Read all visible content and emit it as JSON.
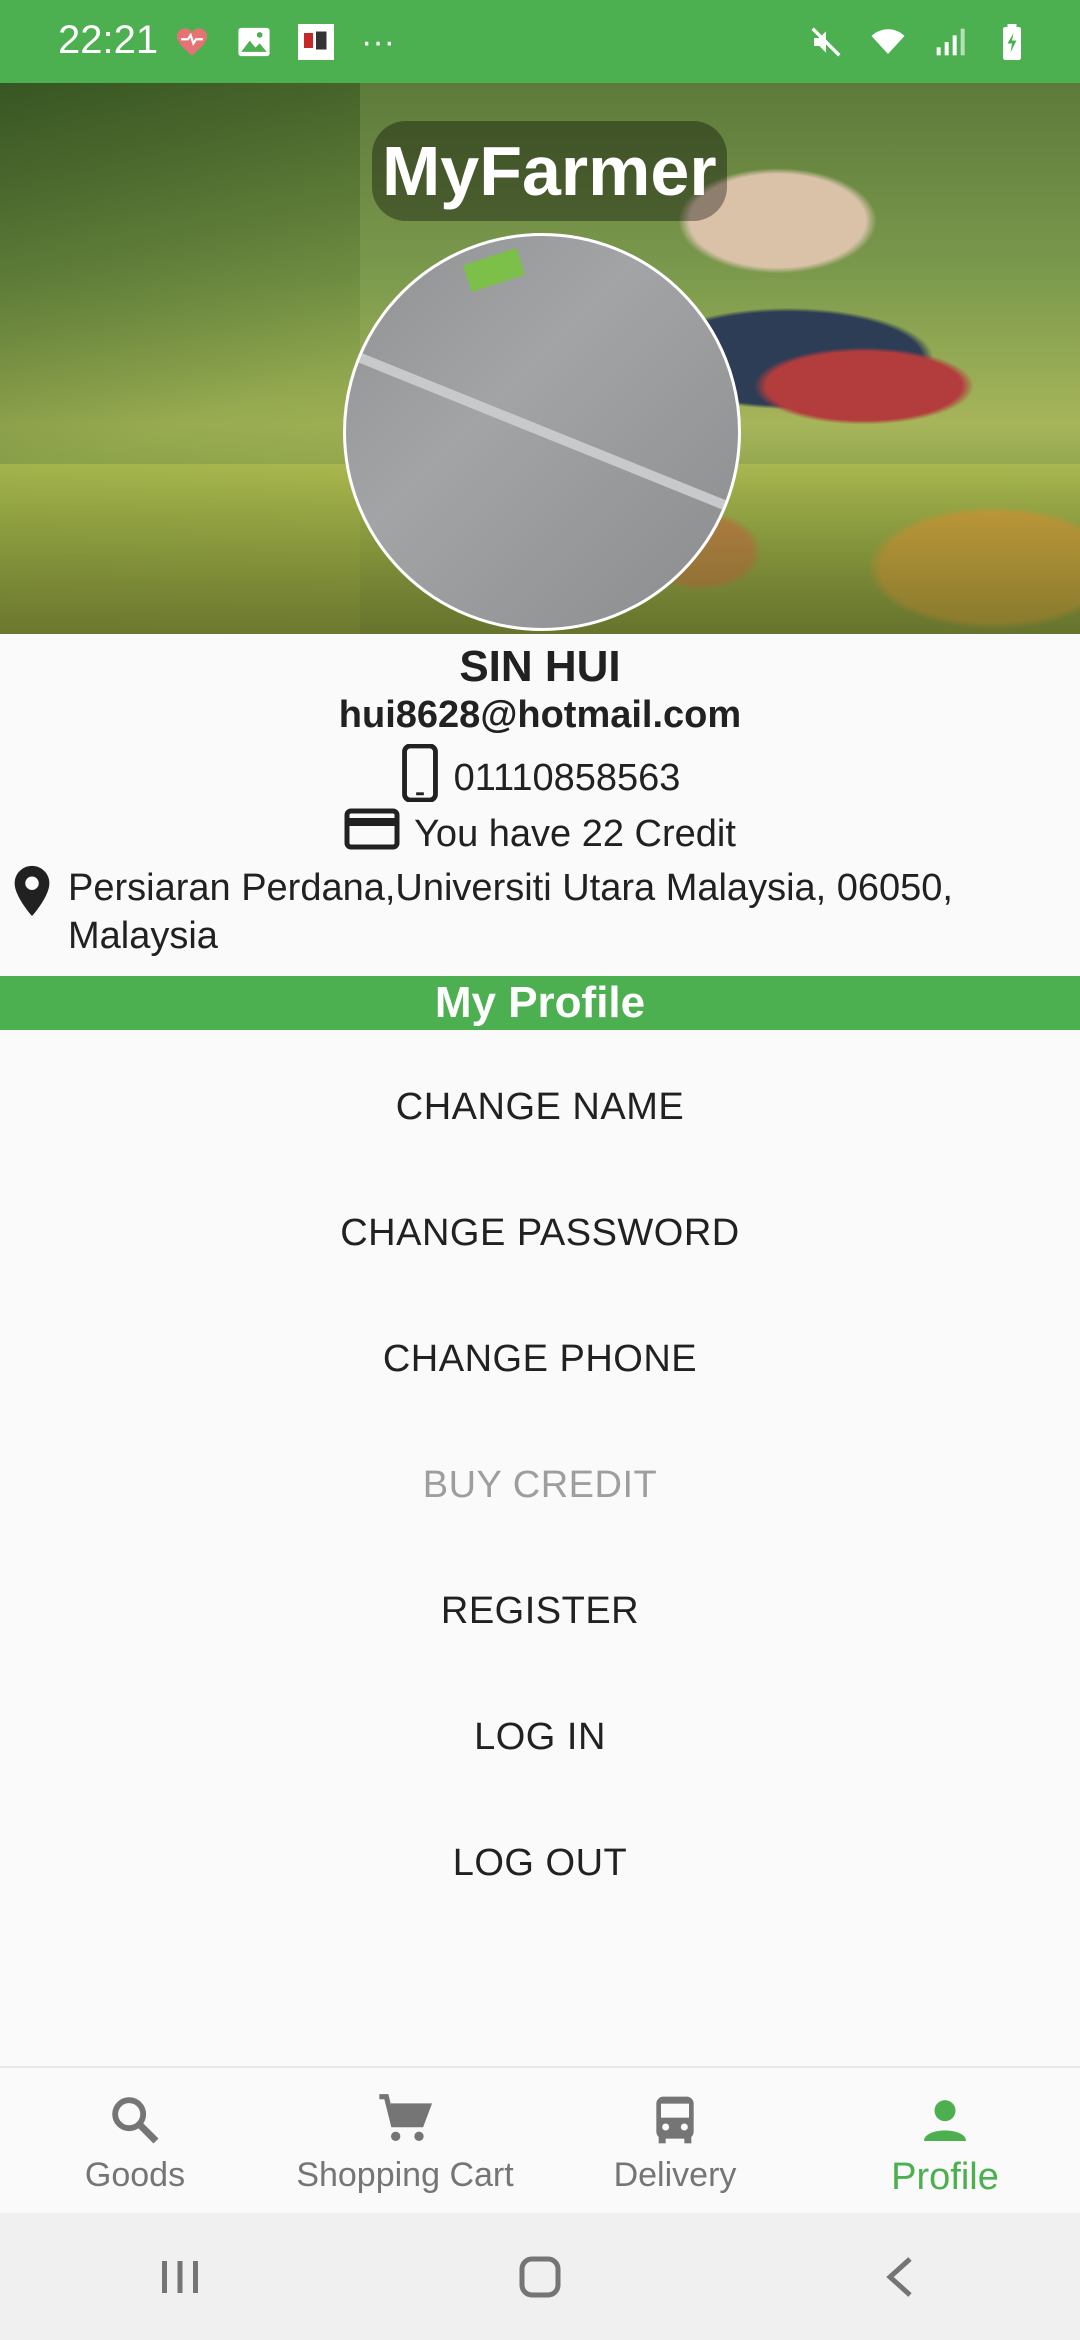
{
  "status_bar": {
    "time": "22:21",
    "left_icons": [
      "heart-icon",
      "image-icon",
      "app-notification-icon",
      "more-dots-icon"
    ],
    "right_icons": [
      "mute-icon",
      "wifi-icon",
      "signal-icon",
      "battery-icon"
    ],
    "more_dots": "···"
  },
  "header": {
    "app_title": "MyFarmer"
  },
  "profile": {
    "name": "SIN HUI",
    "email": "hui8628@hotmail.com",
    "phone": "01110858563",
    "credit_text": "You have 22 Credit",
    "address": "Persiaran Perdana,Universiti Utara Malaysia, 06050, Malaysia"
  },
  "section": {
    "title": "My Profile"
  },
  "menu": {
    "items": [
      {
        "label": "CHANGE NAME",
        "enabled": true
      },
      {
        "label": "CHANGE PASSWORD",
        "enabled": true
      },
      {
        "label": "CHANGE PHONE",
        "enabled": true
      },
      {
        "label": "BUY CREDIT",
        "enabled": false
      },
      {
        "label": "REGISTER",
        "enabled": true
      },
      {
        "label": "LOG IN",
        "enabled": true
      },
      {
        "label": "LOG OUT",
        "enabled": true
      }
    ]
  },
  "bottom_nav": {
    "items": [
      {
        "label": "Goods",
        "icon": "search-icon"
      },
      {
        "label": "Shopping Cart",
        "icon": "cart-icon"
      },
      {
        "label": "Delivery",
        "icon": "bus-icon"
      },
      {
        "label": "Profile",
        "icon": "person-icon",
        "active": true
      }
    ]
  },
  "colors": {
    "accent": "#4caf50",
    "disabled": "#9e9e9e",
    "text": "#212121"
  }
}
